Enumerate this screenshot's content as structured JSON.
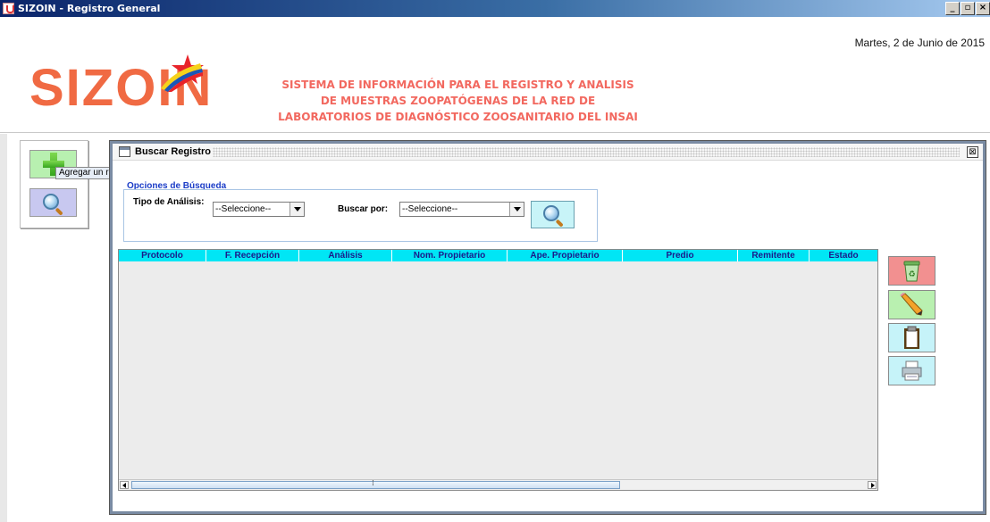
{
  "window": {
    "title": "SIZOIN - Registro General",
    "controls": [
      "_",
      "▫",
      "×"
    ]
  },
  "header": {
    "date": "Martes, 2 de Junio de 2015",
    "logo_text": "SIZOIN",
    "tagline": [
      "SISTEMA DE INFORMACIÓN PARA EL REGISTRO Y ANALISIS",
      "DE MUESTRAS ZOOPATÓGENAS DE LA RED DE",
      "LABORATORIOS DE DIAGNÓSTICO ZOOSANITARIO DEL INSAI"
    ]
  },
  "left_toolbar": {
    "add_tooltip": "Agregar un registro de muestras",
    "buttons": [
      {
        "name": "add",
        "icon": "plus-icon",
        "color": "#b8f0b0"
      },
      {
        "name": "search",
        "icon": "magnifier-icon",
        "color": "#c8c8f0"
      }
    ]
  },
  "frame": {
    "title": "Buscar Registro",
    "close": "⊠",
    "options": {
      "group_label": "Opciones de Búsqueda",
      "tipo_label": "Tipo de Análisis:",
      "tipo_value": "--Seleccione--",
      "buscar_label": "Buscar por:",
      "buscar_value": "--Seleccione--"
    },
    "table": {
      "columns": [
        "Protocolo",
        "F. Recepción",
        "Análisis",
        "Nom. Propietario",
        "Ape. Propietario",
        "Predio",
        "Remitente",
        "Estado"
      ],
      "rows": []
    },
    "actions": [
      {
        "name": "delete",
        "icon": "recycle-bin-icon",
        "color": "#f29090"
      },
      {
        "name": "edit",
        "icon": "pencil-icon",
        "color": "#b9f0b0"
      },
      {
        "name": "clipboard",
        "icon": "clipboard-icon",
        "color": "#c6f3f9"
      },
      {
        "name": "print",
        "icon": "printer-icon",
        "color": "#c6f3f9"
      }
    ]
  }
}
